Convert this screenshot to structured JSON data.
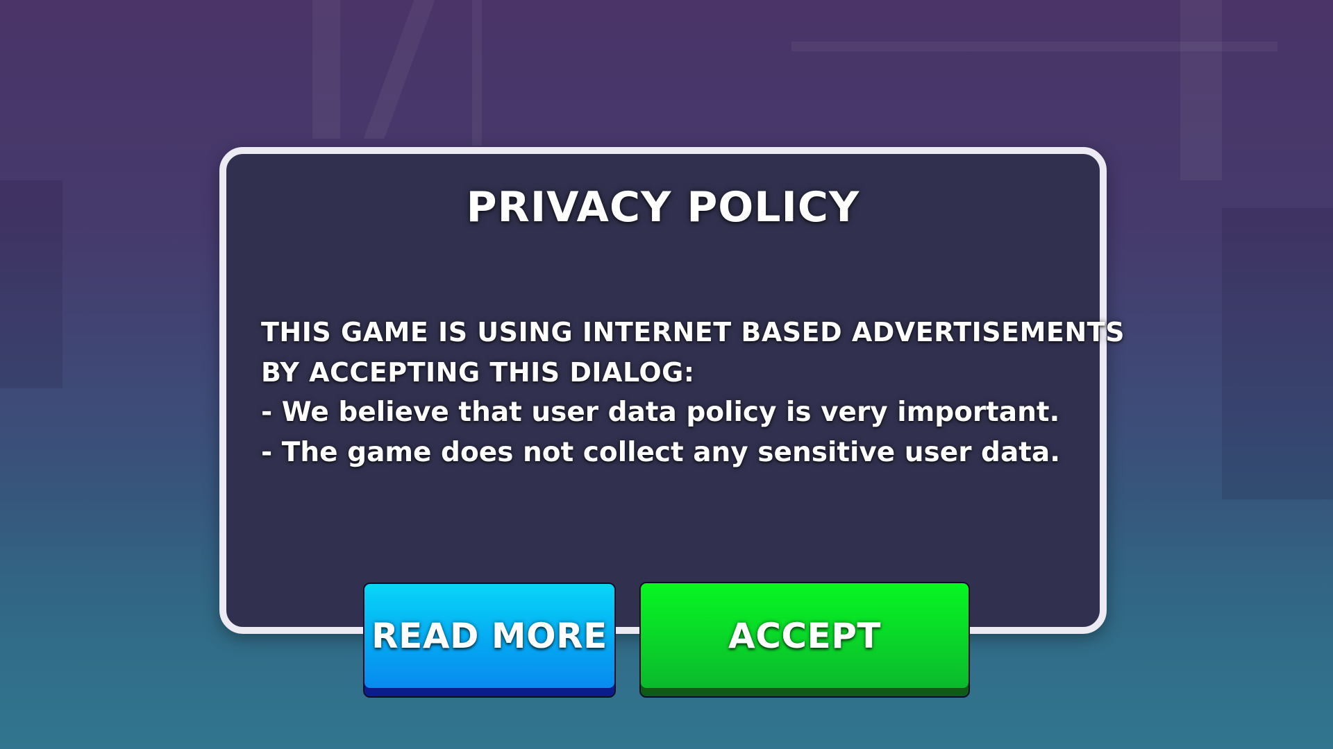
{
  "dialog": {
    "title": "PRIVACY POLICY",
    "lines": [
      "THIS GAME IS USING INTERNET BASED ADVERTISEMENTS",
      "BY ACCEPTING THIS DIALOG:",
      "- We believe that user data policy is very important.",
      "- The game does not collect any sensitive user data."
    ]
  },
  "buttons": {
    "read_more": "READ MORE",
    "accept": "ACCEPT"
  },
  "colors": {
    "panel": "#31314f",
    "panel_border": "#eceaf2",
    "read_more": "#06a6f2",
    "accept": "#0ad22a"
  }
}
